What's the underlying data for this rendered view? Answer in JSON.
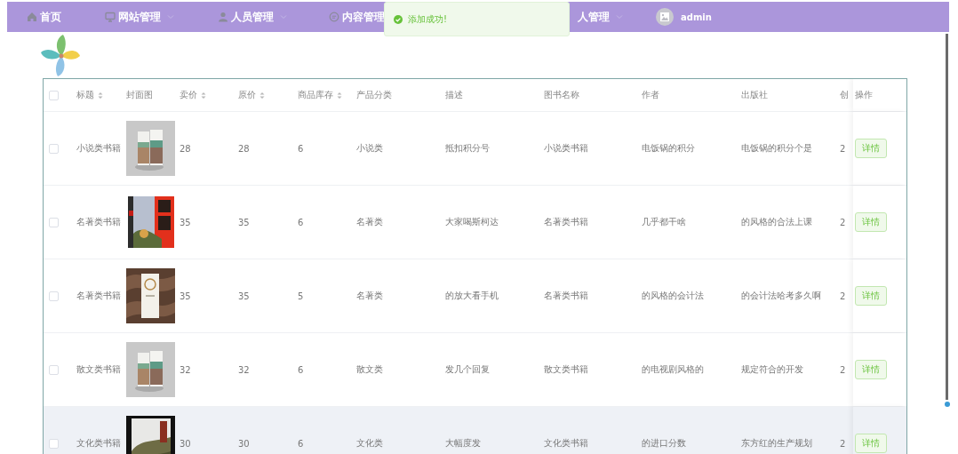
{
  "nav": {
    "items": [
      {
        "label": "首页",
        "dropdown": false
      },
      {
        "label": "网站管理",
        "dropdown": true
      },
      {
        "label": "人员管理",
        "dropdown": true
      },
      {
        "label": "内容管理",
        "dropdown": false
      },
      {
        "label": "人管理",
        "dropdown": true
      }
    ],
    "user": {
      "name": "admin"
    }
  },
  "toast": {
    "message": "添加成功!"
  },
  "table": {
    "select_all_checked": false,
    "columns": [
      {
        "label": "标题",
        "sortable": true
      },
      {
        "label": "封面图",
        "sortable": false
      },
      {
        "label": "卖价",
        "sortable": true
      },
      {
        "label": "原价",
        "sortable": true
      },
      {
        "label": "商品库存",
        "sortable": true
      },
      {
        "label": "产品分类",
        "sortable": false
      },
      {
        "label": "描述",
        "sortable": false
      },
      {
        "label": "图书名称",
        "sortable": false
      },
      {
        "label": "作者",
        "sortable": false
      },
      {
        "label": "出版社",
        "sortable": false
      },
      {
        "label": "创",
        "sortable": false
      },
      {
        "label": "操作",
        "sortable": false
      }
    ],
    "rows": [
      {
        "checked": false,
        "highlighted": false,
        "cells": [
          "小说类书籍",
          {
            "kind": "picture"
          },
          "28",
          "28",
          "6",
          "小说类",
          "抵扣积分号",
          "小说类书籍",
          "电饭锅的积分",
          "电饭锅的积分个是",
          "2",
          {
            "kind": "button",
            "label": "详情"
          }
        ]
      },
      {
        "checked": false,
        "highlighted": false,
        "cells": [
          "名著类书籍",
          {
            "kind": "picture"
          },
          "35",
          "35",
          "6",
          "名著类",
          "大家喝斯柯达",
          "名著类书籍",
          "几乎都干啥",
          "的风格的合法上课",
          "2",
          {
            "kind": "button",
            "label": "详情"
          }
        ]
      },
      {
        "checked": false,
        "highlighted": false,
        "cells": [
          "名著类书籍",
          {
            "kind": "picture"
          },
          "35",
          "35",
          "5",
          "名著类",
          "的放大看手机",
          "名著类书籍",
          "的风格的会计法",
          "的会计法哈考多久啊",
          "2",
          {
            "kind": "button",
            "label": "详情"
          }
        ]
      },
      {
        "checked": false,
        "highlighted": false,
        "cells": [
          "散文类书籍",
          {
            "kind": "picture"
          },
          "32",
          "32",
          "6",
          "散文类",
          "发几个回复",
          "散文类书籍",
          "的电视剧风格的",
          "规定符合的开发",
          "2",
          {
            "kind": "button",
            "label": "详情"
          }
        ]
      },
      {
        "checked": false,
        "highlighted": true,
        "cells": [
          "文化类书籍",
          {
            "kind": "picture"
          },
          "30",
          "30",
          "6",
          "文化类",
          "大幅度发",
          "文化类书籍",
          "的进口分数",
          "东方红的生产规划",
          "2",
          {
            "kind": "button",
            "label": "详情"
          }
        ]
      }
    ]
  }
}
